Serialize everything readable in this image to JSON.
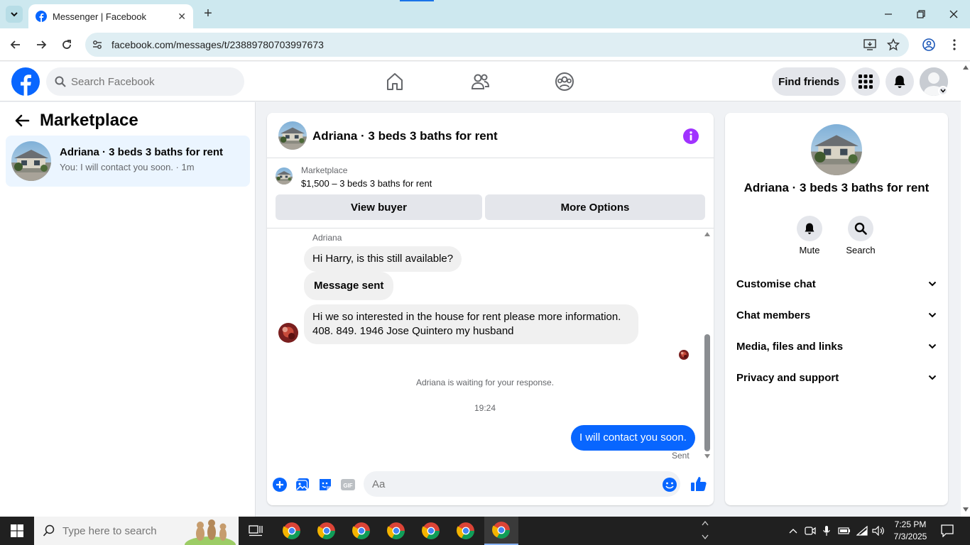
{
  "browser": {
    "tab_title": "Messenger | Facebook",
    "url": "facebook.com/messages/t/23889780703997673"
  },
  "fb": {
    "search_placeholder": "Search Facebook",
    "find_friends": "Find friends"
  },
  "left": {
    "title": "Marketplace",
    "conversation": {
      "name": "Adriana · 3 beds 3 baths for rent",
      "preview": "You: I will contact you soon. · 1m"
    }
  },
  "chat": {
    "header_name": "Adriana · 3 beds 3 baths for rent",
    "marketplace_label": "Marketplace",
    "listing": "$1,500 – 3 beds 3 baths for rent",
    "view_buyer": "View buyer",
    "more_options": "More Options",
    "sender_name": "Adriana",
    "messages": [
      {
        "text": "Hi Harry, is this still available?"
      },
      {
        "text": "Message sent"
      },
      {
        "text": "Hi we so interested in the house for rent please more information. 408. 849. 1946 Jose Quintero my husband"
      }
    ],
    "waiting_note": "Adriana is waiting for your response.",
    "time": "19:24",
    "outgoing": "I will contact you soon.",
    "status": "Sent",
    "composer_placeholder": "Aa"
  },
  "right": {
    "name": "Adriana · 3 beds 3 baths for rent",
    "mute": "Mute",
    "search": "Search",
    "sections": [
      "Customise chat",
      "Chat members",
      "Media, files and links",
      "Privacy and support"
    ]
  },
  "taskbar": {
    "search_placeholder": "Type here to search",
    "time": "7:25 PM",
    "date": "7/3/2025"
  },
  "colors": {
    "fb_blue": "#0866ff",
    "info_purple": "#a033ff",
    "selected_bg": "#ebf5ff"
  }
}
